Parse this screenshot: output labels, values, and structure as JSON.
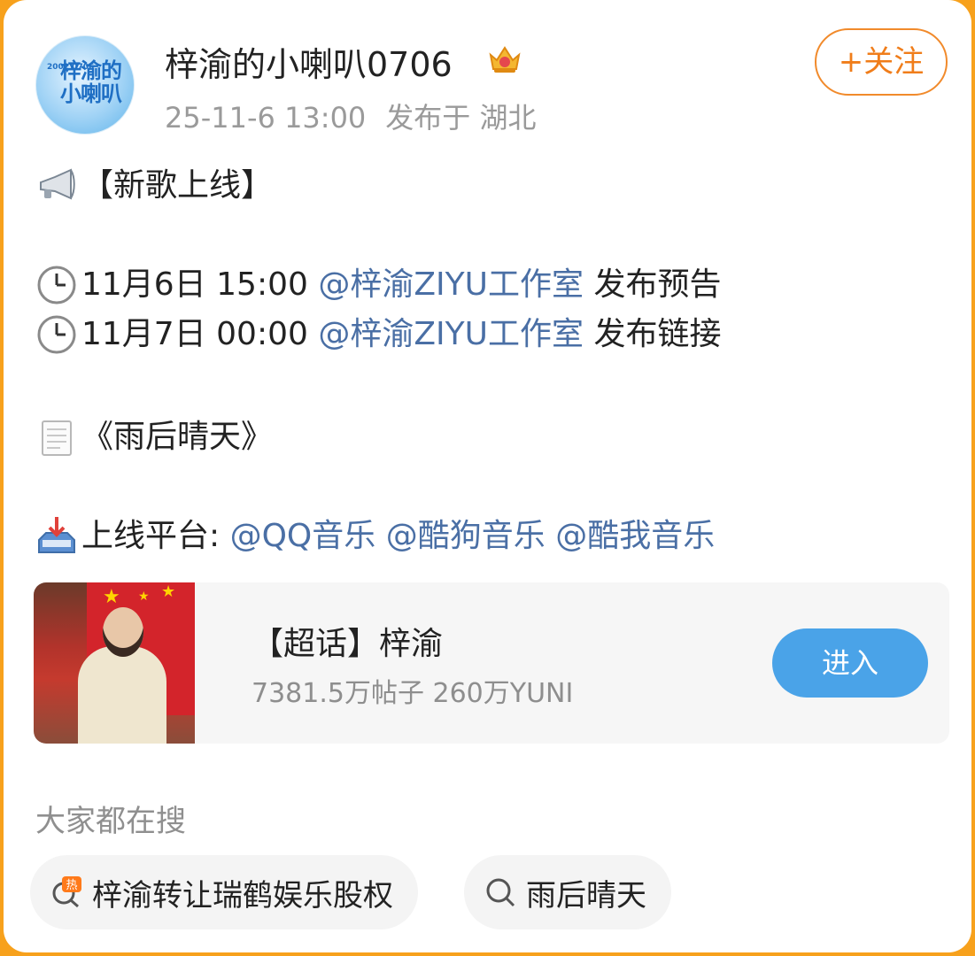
{
  "post": {
    "username": "梓渝的小喇叭0706",
    "avatar_text": "梓渝的小喇叭",
    "avatar_tag": "2002 0706",
    "timestamp": "25-11-6 13:00",
    "location": "发布于 湖北",
    "follow_label": "+关注",
    "title": "【新歌上线】",
    "schedule": [
      {
        "time": "11月6日 15:00",
        "mention": "@梓渝ZIYU工作室",
        "action": "发布预告"
      },
      {
        "time": "11月7日 00:00",
        "mention": "@梓渝ZIYU工作室",
        "action": "发布链接"
      }
    ],
    "song": "《雨后晴天》",
    "platform_label": "上线平台:",
    "platforms": [
      "@QQ音乐",
      "@酷狗音乐",
      "@酷我音乐"
    ]
  },
  "topic_card": {
    "title": "【超话】梓渝",
    "stats": "7381.5万帖子 260万YUNI",
    "enter_label": "进入"
  },
  "trending": {
    "heading": "大家都在搜",
    "hot_badge": "热",
    "items": [
      "梓渝转让瑞鹤娱乐股权",
      "雨后晴天"
    ]
  },
  "icons": {
    "announce": "megaphone-icon",
    "clock": "clock-icon",
    "doc": "memo-icon",
    "inbox": "inbox-tray-icon",
    "crown": "crown-badge-icon",
    "hot_search": "hot-search-icon",
    "search": "search-icon"
  },
  "colors": {
    "frame": "#f7a11c",
    "mention": "#4a6fa5",
    "follow": "#f07d1a",
    "enter_button": "#4aa3e8"
  }
}
